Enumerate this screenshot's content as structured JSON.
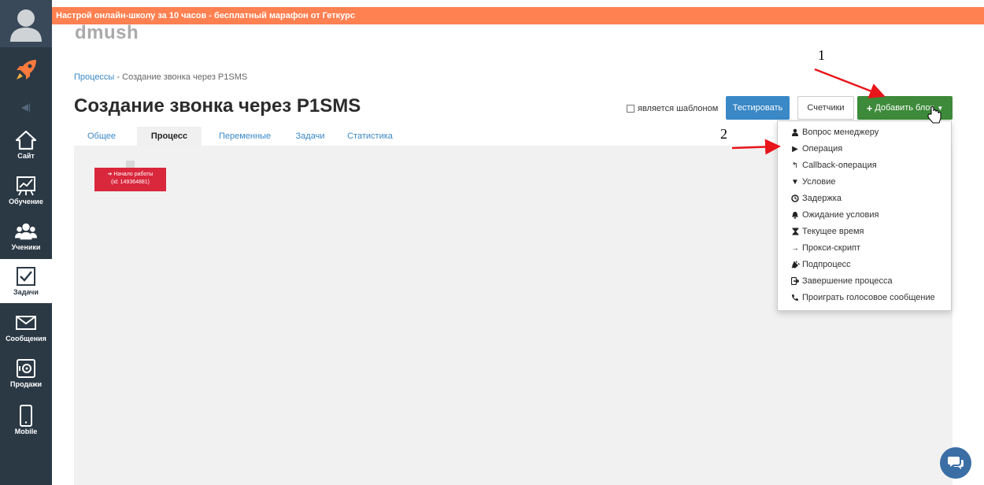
{
  "banner": {
    "text": "Настрой онлайн-школу за 10 часов - бесплатный марафон от Геткурс"
  },
  "school": {
    "name": "dmush"
  },
  "breadcrumb": {
    "parent": "Процессы",
    "separator": " - ",
    "current": "Создание звонка через P1SMS"
  },
  "page": {
    "title": "Создание звонка через P1SMS"
  },
  "toolbar": {
    "template_label": "является шаблоном",
    "test_label": "Тестировать",
    "counters_label": "Счетчики",
    "add_block_label": "Добавить блок"
  },
  "tabs": [
    {
      "label": "Общее"
    },
    {
      "label": "Процесс"
    },
    {
      "label": "Переменные"
    },
    {
      "label": "Задачи"
    },
    {
      "label": "Статистика"
    }
  ],
  "start_node": {
    "line1": "Начало работы",
    "line2": "(id: 149364881)"
  },
  "dropdown": {
    "items": [
      {
        "label": "Вопрос менеджеру",
        "icon": "user-icon"
      },
      {
        "label": "Операция",
        "icon": "play-icon"
      },
      {
        "label": "Callback-операция",
        "icon": "reply-icon"
      },
      {
        "label": "Условие",
        "icon": "filter-icon"
      },
      {
        "label": "Задержка",
        "icon": "clock-icon"
      },
      {
        "label": "Ожидание условия",
        "icon": "bell-icon"
      },
      {
        "label": "Текущее время",
        "icon": "hourglass-icon"
      },
      {
        "label": "Прокси-скрипт",
        "icon": "arrow-right-icon"
      },
      {
        "label": "Подпроцесс",
        "icon": "plug-icon"
      },
      {
        "label": "Завершение процесса",
        "icon": "sign-out-icon"
      },
      {
        "label": "Проиграть голосовое сообщение",
        "icon": "phone-icon"
      }
    ]
  },
  "sidebar": {
    "items": [
      {
        "label": "Сайт",
        "icon": "house-icon"
      },
      {
        "label": "Обучение",
        "icon": "chart-board-icon"
      },
      {
        "label": "Ученики",
        "icon": "users-icon"
      },
      {
        "label": "Задачи",
        "icon": "checkbox-icon"
      },
      {
        "label": "Сообщения",
        "icon": "envelope-icon"
      },
      {
        "label": "Продажи",
        "icon": "safe-icon"
      },
      {
        "label": "Mobile",
        "icon": "phone-device-icon"
      }
    ]
  },
  "annotations": {
    "first": "1",
    "second": "2"
  },
  "colors": {
    "sidebar": "#2b3945",
    "banner": "#ff8050",
    "primary": "#3a88c6",
    "success": "#3d8a3a",
    "danger": "#d9273c",
    "arrow": "#e8151b"
  }
}
